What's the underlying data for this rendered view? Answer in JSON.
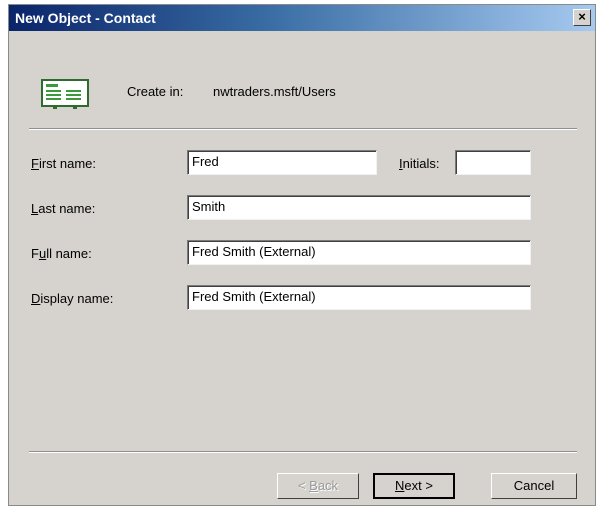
{
  "window": {
    "title": "New Object - Contact",
    "close_label": "×"
  },
  "header": {
    "create_in_label": "Create in:",
    "create_in_path": "nwtraders.msft/Users"
  },
  "form": {
    "first_name": {
      "label_prefix": "",
      "label_key": "F",
      "label_suffix": "irst name:",
      "value": "Fred"
    },
    "initials": {
      "label_prefix": "",
      "label_key": "I",
      "label_suffix": "nitials:",
      "value": ""
    },
    "last_name": {
      "label_prefix": "",
      "label_key": "L",
      "label_suffix": "ast name:",
      "value": "Smith"
    },
    "full_name": {
      "label_prefix": "F",
      "label_key": "u",
      "label_suffix": "ll name:",
      "value": "Fred Smith (External)"
    },
    "display_name": {
      "label_prefix": "",
      "label_key": "D",
      "label_suffix": "isplay name:",
      "value": "Fred Smith (External)"
    }
  },
  "buttons": {
    "back": {
      "prefix": "< ",
      "key": "B",
      "suffix": "ack"
    },
    "next": {
      "prefix": "",
      "key": "N",
      "suffix": "ext >"
    },
    "cancel": "Cancel"
  },
  "colors": {
    "dialog_bg": "#d6d3ce",
    "titlebar_start": "#0a246a",
    "titlebar_end": "#a6caf0"
  }
}
